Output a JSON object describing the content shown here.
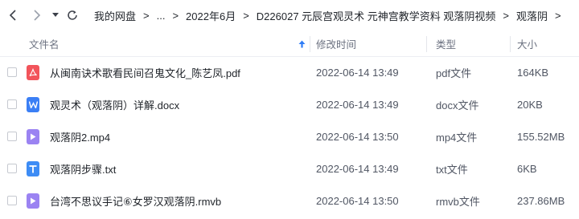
{
  "breadcrumbs": [
    "我的网盘",
    "...",
    "2022年6月",
    "D226027 元辰宫观灵术 元神宫教学资料 观落阴视频",
    "观落阴"
  ],
  "columns": {
    "name": "文件名",
    "modified": "修改时间",
    "type": "类型",
    "size": "大小"
  },
  "files": [
    {
      "name": "从闽南诀术歌看民间召鬼文化_陈艺凤.pdf",
      "modified": "2022-06-14 13:49",
      "type": "pdf文件",
      "size": "164KB",
      "icon": "pdf-icon"
    },
    {
      "name": "观灵术（观落阴）详解.docx",
      "modified": "2022-06-14 13:49",
      "type": "docx文件",
      "size": "20KB",
      "icon": "word-doc-icon"
    },
    {
      "name": "观落阴2.mp4",
      "modified": "2022-06-14 13:50",
      "type": "mp4文件",
      "size": "155.52MB",
      "icon": "video-file-icon"
    },
    {
      "name": "观落阴步骤.txt",
      "modified": "2022-06-14 13:49",
      "type": "txt文件",
      "size": "6KB",
      "icon": "text-file-icon"
    },
    {
      "name": "台湾不思议手记⑥女罗汉观落阴.rmvb",
      "modified": "2022-06-14 13:50",
      "type": "rmvb文件",
      "size": "237.86MB",
      "icon": "video-file-icon"
    }
  ],
  "colors": {
    "pdf": "#f2545b",
    "word": "#3b7ff5",
    "video": "#9b83f2",
    "text": "#3d8cf5",
    "sort_arrow": "#2f7df6"
  }
}
